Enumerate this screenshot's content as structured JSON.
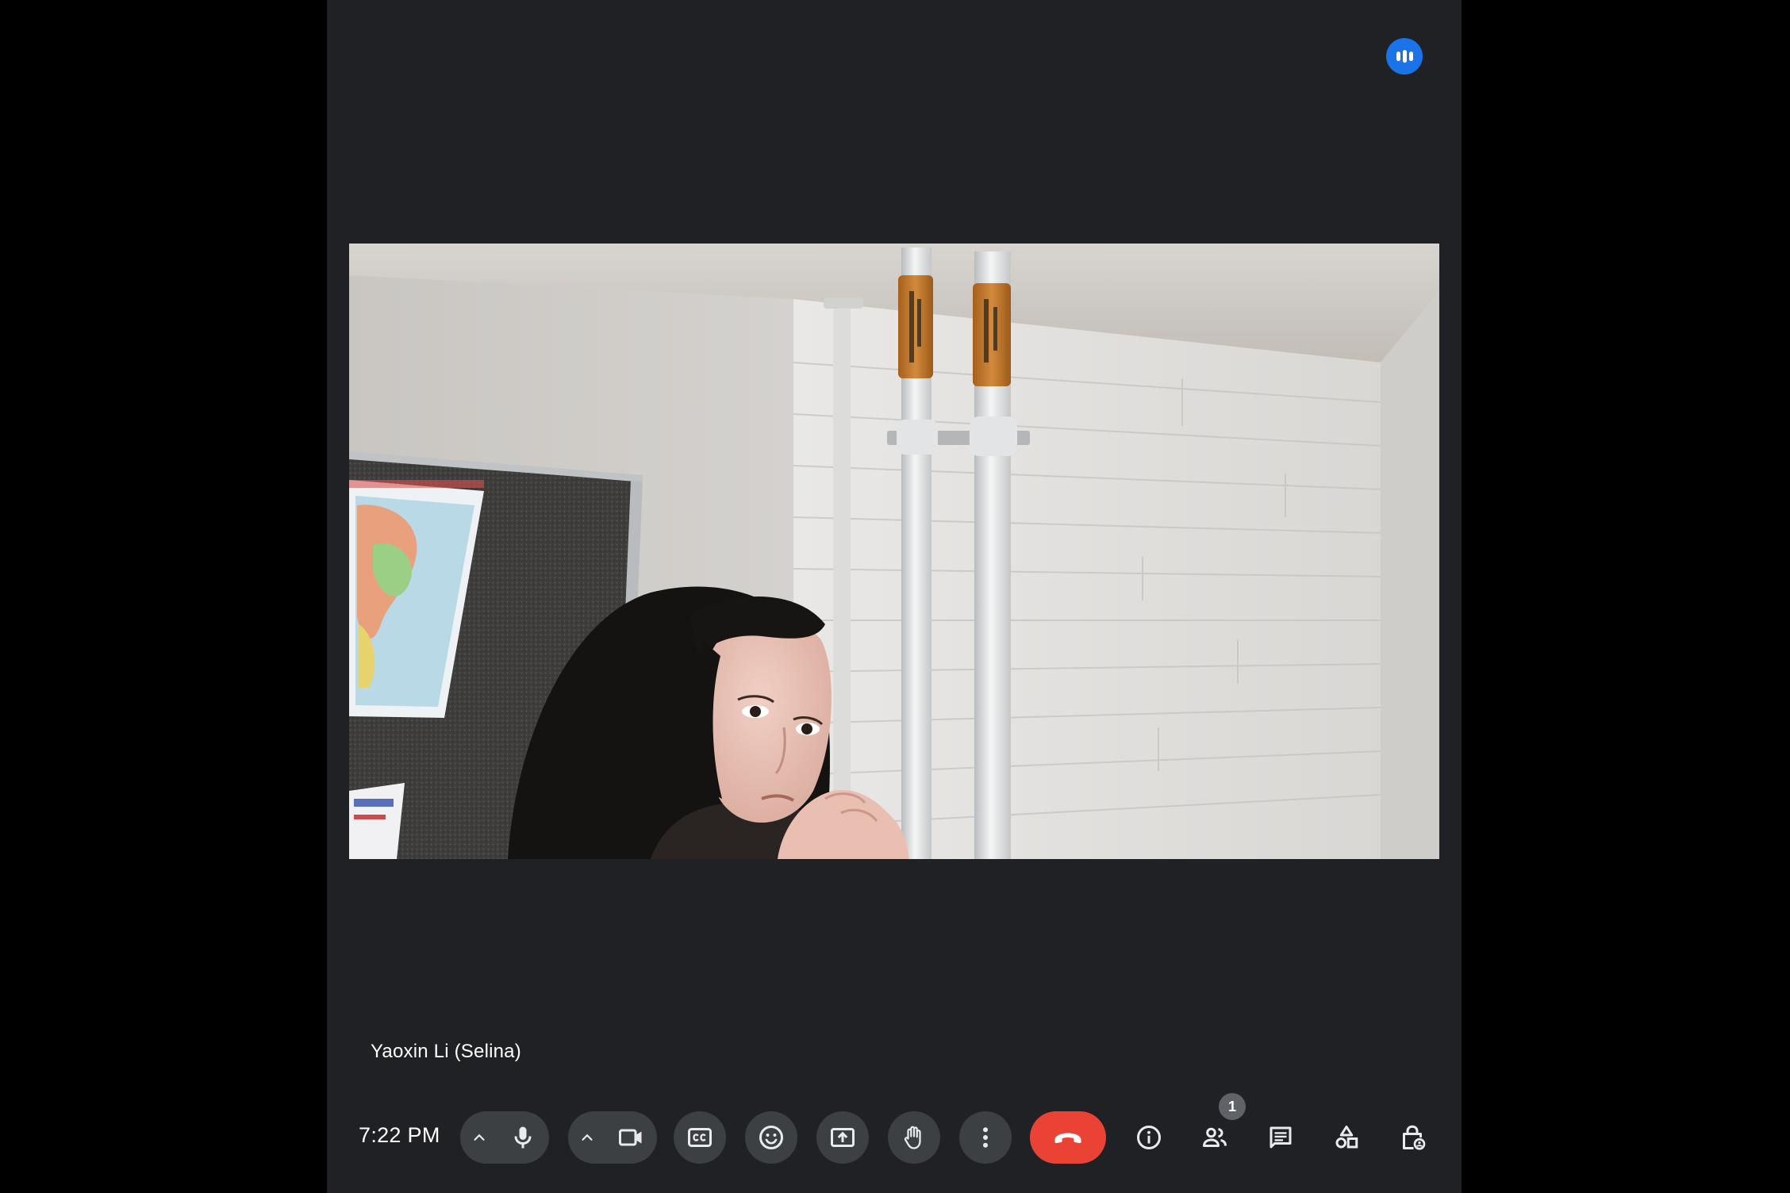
{
  "meeting": {
    "participant_name": "Yaoxin Li (Selina)",
    "clock": "7:22 PM",
    "people_count": "1"
  },
  "icons": {
    "activity_indicator": "speaking-indicator-icon",
    "mic_options": "chevron-up-icon",
    "mic": "microphone-icon",
    "camera_options": "chevron-up-icon",
    "camera": "videocam-icon",
    "captions": "closed-captions-icon",
    "reactions": "emoji-icon",
    "present": "present-screen-icon",
    "raise_hand": "raise-hand-icon",
    "more_options": "more-vert-icon",
    "end_call": "call-end-icon",
    "meeting_details": "info-icon",
    "people": "people-icon",
    "chat": "chat-icon",
    "activities": "shapes-icon",
    "host_controls": "lock-person-icon"
  },
  "colors": {
    "stage_background": "#202124",
    "button_background": "#3c4043",
    "end_call": "#ea4335",
    "accent_blue": "#1a73e8",
    "icon": "#e8eaed"
  }
}
